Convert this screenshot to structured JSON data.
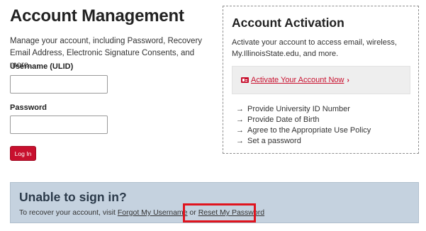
{
  "left": {
    "title": "Account Management",
    "intro": "Manage your account, including Password, Recovery Email Address, Electronic Signature Consents, and more.",
    "username_label": "Username (ULID)",
    "username_value": "",
    "password_label": "Password",
    "password_value": "",
    "login_label": "Log In"
  },
  "card": {
    "title": "Account Activation",
    "description": "Activate your account to access email, wireless, My.IllinoisState.edu, and more.",
    "activate_link": "Activate Your Account Now",
    "steps": [
      "Provide University ID Number",
      "Provide Date of Birth",
      "Agree to the Appropriate Use Policy",
      "Set a password"
    ]
  },
  "unable": {
    "title": "Unable to sign in?",
    "prefix": "To recover your account, visit ",
    "link1": "Forgot My Username",
    "middle": " or ",
    "link2": "Reset My Password"
  },
  "colors": {
    "brand_red": "#c8102e",
    "panel_blue": "#c5d2df",
    "highlight_red": "#e0141e"
  },
  "icons": {
    "activate": "id-card-icon",
    "activate_chevron": "chevron-right-icon",
    "step_bullet": "arrow-right-icon"
  }
}
